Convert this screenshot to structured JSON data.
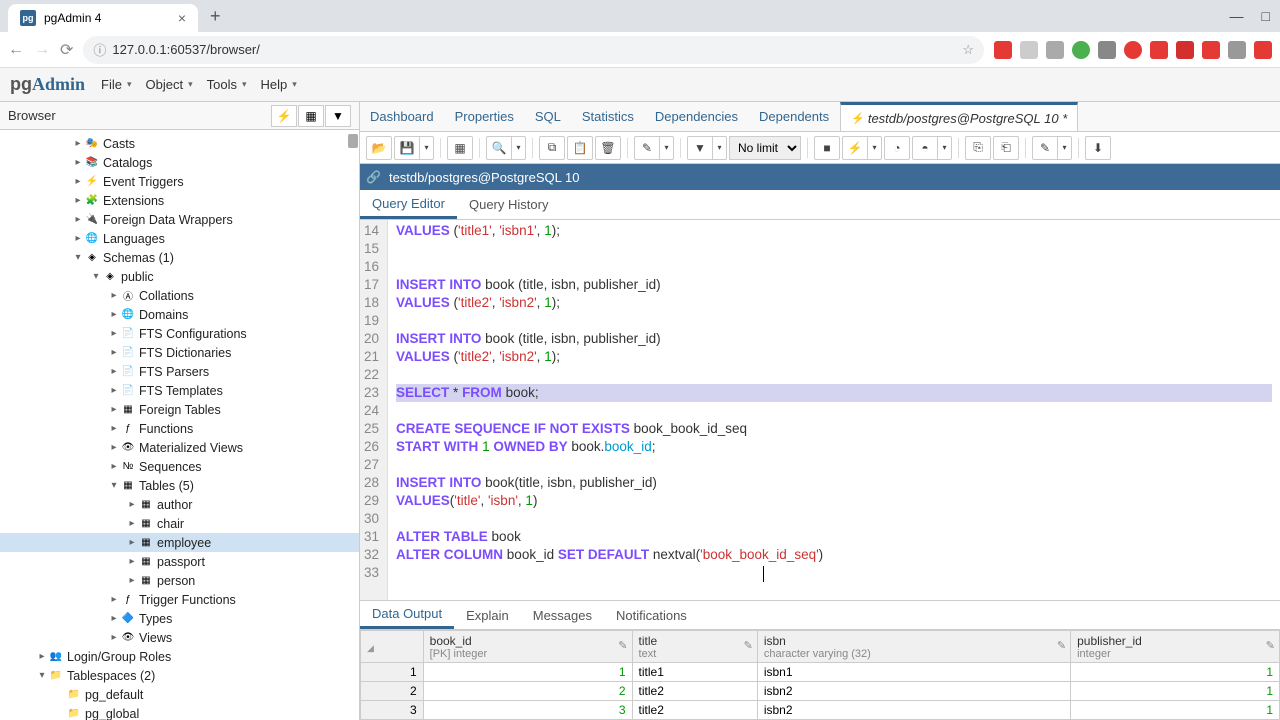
{
  "browser": {
    "tab_title": "pgAdmin 4",
    "url": "127.0.0.1:60537/browser/"
  },
  "menus": [
    "File",
    "Object",
    "Tools",
    "Help"
  ],
  "sidebar": {
    "title": "Browser",
    "tree": [
      {
        "label": "Casts",
        "indent": 4,
        "chev": ">",
        "icon": "cast"
      },
      {
        "label": "Catalogs",
        "indent": 4,
        "chev": ">",
        "icon": "catalog"
      },
      {
        "label": "Event Triggers",
        "indent": 4,
        "chev": ">",
        "icon": "trigger"
      },
      {
        "label": "Extensions",
        "indent": 4,
        "chev": ">",
        "icon": "ext"
      },
      {
        "label": "Foreign Data Wrappers",
        "indent": 4,
        "chev": ">",
        "icon": "fdw"
      },
      {
        "label": "Languages",
        "indent": 4,
        "chev": ">",
        "icon": "lang"
      },
      {
        "label": "Schemas (1)",
        "indent": 4,
        "chev": "v",
        "icon": "schema"
      },
      {
        "label": "public",
        "indent": 5,
        "chev": "v",
        "icon": "public"
      },
      {
        "label": "Collations",
        "indent": 6,
        "chev": ">",
        "icon": "coll"
      },
      {
        "label": "Domains",
        "indent": 6,
        "chev": ">",
        "icon": "domain"
      },
      {
        "label": "FTS Configurations",
        "indent": 6,
        "chev": ">",
        "icon": "fts"
      },
      {
        "label": "FTS Dictionaries",
        "indent": 6,
        "chev": ">",
        "icon": "fts"
      },
      {
        "label": "FTS Parsers",
        "indent": 6,
        "chev": ">",
        "icon": "fts"
      },
      {
        "label": "FTS Templates",
        "indent": 6,
        "chev": ">",
        "icon": "fts"
      },
      {
        "label": "Foreign Tables",
        "indent": 6,
        "chev": ">",
        "icon": "ftable"
      },
      {
        "label": "Functions",
        "indent": 6,
        "chev": ">",
        "icon": "func"
      },
      {
        "label": "Materialized Views",
        "indent": 6,
        "chev": ">",
        "icon": "mview"
      },
      {
        "label": "Sequences",
        "indent": 6,
        "chev": ">",
        "icon": "seq"
      },
      {
        "label": "Tables (5)",
        "indent": 6,
        "chev": "v",
        "icon": "tables"
      },
      {
        "label": "author",
        "indent": 7,
        "chev": ">",
        "icon": "table"
      },
      {
        "label": "chair",
        "indent": 7,
        "chev": ">",
        "icon": "table"
      },
      {
        "label": "employee",
        "indent": 7,
        "chev": ">",
        "icon": "table",
        "selected": true
      },
      {
        "label": "passport",
        "indent": 7,
        "chev": ">",
        "icon": "table"
      },
      {
        "label": "person",
        "indent": 7,
        "chev": ">",
        "icon": "table"
      },
      {
        "label": "Trigger Functions",
        "indent": 6,
        "chev": ">",
        "icon": "tfunc"
      },
      {
        "label": "Types",
        "indent": 6,
        "chev": ">",
        "icon": "types"
      },
      {
        "label": "Views",
        "indent": 6,
        "chev": ">",
        "icon": "views"
      },
      {
        "label": "Login/Group Roles",
        "indent": 2,
        "chev": ">",
        "icon": "roles"
      },
      {
        "label": "Tablespaces (2)",
        "indent": 2,
        "chev": "v",
        "icon": "ts"
      },
      {
        "label": "pg_default",
        "indent": 3,
        "chev": "",
        "icon": "tsi"
      },
      {
        "label": "pg_global",
        "indent": 3,
        "chev": "",
        "icon": "tsi"
      }
    ]
  },
  "top_tabs": [
    "Dashboard",
    "Properties",
    "SQL",
    "Statistics",
    "Dependencies",
    "Dependents"
  ],
  "active_tab": "testdb/postgres@PostgreSQL 10 *",
  "connection": "testdb/postgres@PostgreSQL 10",
  "sub_tabs": {
    "items": [
      "Query Editor",
      "Query History"
    ],
    "active": 0
  },
  "limit_options": [
    "No limit"
  ],
  "code_lines": [
    {
      "n": 14,
      "tokens": [
        [
          "kw",
          "VALUES"
        ],
        [
          "id",
          " ("
        ],
        [
          "str",
          "'title1'"
        ],
        [
          "id",
          ", "
        ],
        [
          "str",
          "'isbn1'"
        ],
        [
          "id",
          ", "
        ],
        [
          "num",
          "1"
        ],
        [
          "id",
          ");"
        ]
      ]
    },
    {
      "n": 15,
      "tokens": []
    },
    {
      "n": 16,
      "tokens": []
    },
    {
      "n": 17,
      "tokens": [
        [
          "kw",
          "INSERT"
        ],
        [
          "id",
          " "
        ],
        [
          "kw",
          "INTO"
        ],
        [
          "id",
          " book (title, isbn, publisher_id)"
        ]
      ]
    },
    {
      "n": 18,
      "tokens": [
        [
          "kw",
          "VALUES"
        ],
        [
          "id",
          " ("
        ],
        [
          "str",
          "'title2'"
        ],
        [
          "id",
          ", "
        ],
        [
          "str",
          "'isbn2'"
        ],
        [
          "id",
          ", "
        ],
        [
          "num",
          "1"
        ],
        [
          "id",
          ");"
        ]
      ]
    },
    {
      "n": 19,
      "tokens": []
    },
    {
      "n": 20,
      "tokens": [
        [
          "kw",
          "INSERT"
        ],
        [
          "id",
          " "
        ],
        [
          "kw",
          "INTO"
        ],
        [
          "id",
          " book (title, isbn, publisher_id)"
        ]
      ]
    },
    {
      "n": 21,
      "tokens": [
        [
          "kw",
          "VALUES"
        ],
        [
          "id",
          " ("
        ],
        [
          "str",
          "'title2'"
        ],
        [
          "id",
          ", "
        ],
        [
          "str",
          "'isbn2'"
        ],
        [
          "id",
          ", "
        ],
        [
          "num",
          "1"
        ],
        [
          "id",
          ");"
        ]
      ]
    },
    {
      "n": 22,
      "tokens": []
    },
    {
      "n": 23,
      "tokens": [
        [
          "kw",
          "SELECT"
        ],
        [
          "id",
          " * "
        ],
        [
          "kw",
          "FROM"
        ],
        [
          "id",
          " book;"
        ]
      ],
      "hl": true
    },
    {
      "n": 24,
      "tokens": []
    },
    {
      "n": 25,
      "tokens": [
        [
          "kw",
          "CREATE"
        ],
        [
          "id",
          " "
        ],
        [
          "kw",
          "SEQUENCE"
        ],
        [
          "id",
          " "
        ],
        [
          "kw",
          "IF"
        ],
        [
          "id",
          " "
        ],
        [
          "kw",
          "NOT"
        ],
        [
          "id",
          " "
        ],
        [
          "kw",
          "EXISTS"
        ],
        [
          "id",
          " book_book_id_seq"
        ]
      ]
    },
    {
      "n": 26,
      "tokens": [
        [
          "kw",
          "START"
        ],
        [
          "id",
          " "
        ],
        [
          "kw",
          "WITH"
        ],
        [
          "id",
          " "
        ],
        [
          "num",
          "1"
        ],
        [
          "id",
          " "
        ],
        [
          "kw",
          "OWNED"
        ],
        [
          "id",
          " "
        ],
        [
          "kw",
          "BY"
        ],
        [
          "id",
          " book."
        ],
        [
          "fn",
          "book_id"
        ],
        [
          "id",
          ";"
        ]
      ]
    },
    {
      "n": 27,
      "tokens": []
    },
    {
      "n": 28,
      "tokens": [
        [
          "kw",
          "INSERT"
        ],
        [
          "id",
          " "
        ],
        [
          "kw",
          "INTO"
        ],
        [
          "id",
          " book(title, isbn, publisher_id)"
        ]
      ]
    },
    {
      "n": 29,
      "tokens": [
        [
          "kw",
          "VALUES"
        ],
        [
          "id",
          "("
        ],
        [
          "str",
          "'title'"
        ],
        [
          "id",
          ", "
        ],
        [
          "str",
          "'isbn'"
        ],
        [
          "id",
          ", "
        ],
        [
          "num",
          "1"
        ],
        [
          "id",
          ")"
        ]
      ]
    },
    {
      "n": 30,
      "tokens": []
    },
    {
      "n": 31,
      "tokens": [
        [
          "kw",
          "ALTER"
        ],
        [
          "id",
          " "
        ],
        [
          "kw",
          "TABLE"
        ],
        [
          "id",
          " book"
        ]
      ]
    },
    {
      "n": 32,
      "tokens": [
        [
          "kw",
          "ALTER"
        ],
        [
          "id",
          " "
        ],
        [
          "kw",
          "COLUMN"
        ],
        [
          "id",
          " book_id "
        ],
        [
          "kw",
          "SET"
        ],
        [
          "id",
          " "
        ],
        [
          "kw",
          "DEFAULT"
        ],
        [
          "id",
          " nextval("
        ],
        [
          "str",
          "'book_book_id_seq'"
        ],
        [
          "id",
          ")"
        ]
      ]
    },
    {
      "n": 33,
      "tokens": []
    }
  ],
  "result_tabs": {
    "items": [
      "Data Output",
      "Explain",
      "Messages",
      "Notifications"
    ],
    "active": 0
  },
  "grid": {
    "columns": [
      {
        "name": "book_id",
        "type": "[PK] integer"
      },
      {
        "name": "title",
        "type": "text"
      },
      {
        "name": "isbn",
        "type": "character varying (32)"
      },
      {
        "name": "publisher_id",
        "type": "integer"
      }
    ],
    "rows": [
      {
        "book_id": 1,
        "title": "title1",
        "isbn": "isbn1",
        "publisher_id": 1
      },
      {
        "book_id": 2,
        "title": "title2",
        "isbn": "isbn2",
        "publisher_id": 1
      },
      {
        "book_id": 3,
        "title": "title2",
        "isbn": "isbn2",
        "publisher_id": 1
      }
    ]
  }
}
